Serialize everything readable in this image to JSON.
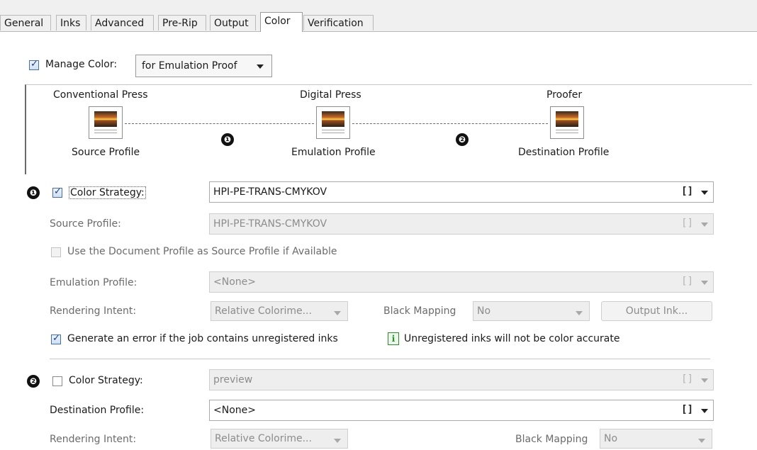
{
  "tabs": [
    "General",
    "Inks",
    "Advanced",
    "Pre-Rip",
    "Output",
    "Color",
    "Verification"
  ],
  "active_tab": "Color",
  "manage_color": {
    "label": "Manage Color:",
    "checked": true,
    "value": "for Emulation Proof"
  },
  "flow": {
    "stages": [
      {
        "title": "Conventional Press",
        "caption": "Source Profile"
      },
      {
        "title": "Digital Press",
        "caption": "Emulation Profile"
      },
      {
        "title": "Proofer",
        "caption": "Destination Profile"
      }
    ],
    "badges": [
      "❶",
      "❷"
    ]
  },
  "section1": {
    "badge": "❶",
    "color_strategy": {
      "label": "Color Strategy:",
      "checked": true,
      "value": "HPI-PE-TRANS-CMYKOV"
    },
    "source_profile": {
      "label": "Source Profile:",
      "value": "HPI-PE-TRANS-CMYKOV"
    },
    "use_document_profile": {
      "label": "Use the Document Profile as Source Profile if Available",
      "checked": false
    },
    "emulation_profile": {
      "label": "Emulation Profile:",
      "value": "<None>"
    },
    "rendering_intent": {
      "label": "Rendering Intent:",
      "value": "Relative Colorime..."
    },
    "black_mapping": {
      "label": "Black Mapping",
      "value": "No"
    },
    "output_ink_button": "Output Ink...",
    "generate_error": {
      "label": "Generate an error if the job contains unregistered inks",
      "checked": true
    },
    "info_text": "Unregistered inks will not be color accurate",
    "info_icon": "i"
  },
  "section2": {
    "badge": "❷",
    "color_strategy": {
      "label": "Color Strategy:",
      "checked": false,
      "value": "preview"
    },
    "destination_profile": {
      "label": "Destination Profile:",
      "value": "<None>"
    },
    "rendering_intent": {
      "label": "Rendering Intent:",
      "value": "Relative Colorime..."
    },
    "black_mapping": {
      "label": "Black Mapping",
      "value": "No"
    }
  },
  "bracket_glyph": "[]",
  "colors": {
    "tab_bar": "#f0f0f0",
    "disabled_field": "#eeeeee",
    "info_icon_green": "#2e8b2e",
    "check_blue": "#1d3f7a"
  }
}
